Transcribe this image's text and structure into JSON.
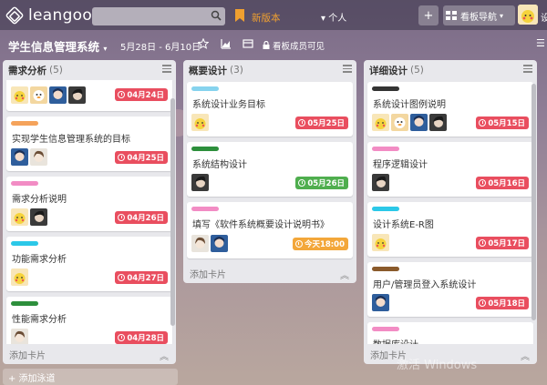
{
  "app": {
    "logo_text": "leangoo"
  },
  "topbar": {
    "search_placeholder": "",
    "new_version": "新版本",
    "personal": "个人",
    "add_symbol": "+",
    "board_nav": "看板导航",
    "more": "设"
  },
  "board": {
    "title": "学生信息管理系统",
    "dates": "5月28日 - 6月10日",
    "visibility": "看板成员可见"
  },
  "lists": [
    {
      "title": "需求分析",
      "count": "(5)",
      "add_card": "添加卡片",
      "cards": [
        {
          "label_color": "",
          "title": "",
          "members": [
            "pikachu",
            "penguin",
            "blue-girl",
            "dark-hair"
          ],
          "due": "04月24日",
          "due_color": "#e94e5f"
        },
        {
          "label_color": "#f5a35b",
          "title": "实现学生信息管理系统的目标",
          "members": [
            "blue-girl",
            "white-girl"
          ],
          "due": "04月25日",
          "due_color": "#e94e5f"
        },
        {
          "label_color": "#f28cc4",
          "title": "需求分析说明",
          "members": [
            "pikachu",
            "dark-hair"
          ],
          "due": "04月26日",
          "due_color": "#e94e5f"
        },
        {
          "label_color": "#2bc8e8",
          "title": "功能需求分析",
          "members": [
            "pikachu"
          ],
          "due": "04月27日",
          "due_color": "#e94e5f"
        },
        {
          "label_color": "#2d8f3c",
          "title": "性能需求分析",
          "members": [
            "white-girl"
          ],
          "due": "04月28日",
          "due_color": "#e94e5f"
        }
      ]
    },
    {
      "title": "概要设计",
      "count": "(3)",
      "add_card": "添加卡片",
      "cards": [
        {
          "label_color": "#86d3ee",
          "title": "系统设计业务目标",
          "members": [
            "pikachu"
          ],
          "due": "05月25日",
          "due_color": "#e94e5f"
        },
        {
          "label_color": "#2d8f3c",
          "title": "系统结构设计",
          "members": [
            "dark-hair"
          ],
          "due": "05月26日",
          "due_color": "#4fae4e"
        },
        {
          "label_color": "#f28cc4",
          "title": "填写《软件系统概要设计说明书》",
          "members": [
            "white-girl",
            "blue-girl"
          ],
          "due": "今天18:00",
          "due_color": "#f3a73a"
        }
      ]
    },
    {
      "title": "详细设计",
      "count": "(5)",
      "add_card": "添加卡片",
      "cards": [
        {
          "label_color": "#333333",
          "title": "系统设计图例说明",
          "members": [
            "pikachu",
            "penguin",
            "blue-girl",
            "dark-hair"
          ],
          "due": "05月15日",
          "due_color": "#e94e5f"
        },
        {
          "label_color": "#f28cc4",
          "title": "程序逻辑设计",
          "members": [
            "dark-hair"
          ],
          "due": "05月16日",
          "due_color": "#e94e5f"
        },
        {
          "label_color": "#2bc8e8",
          "title": "设计系统E-R图",
          "members": [
            "pikachu"
          ],
          "due": "05月17日",
          "due_color": "#e94e5f"
        },
        {
          "label_color": "#8a5a2b",
          "title": "用户/管理员登入系统设计",
          "members": [
            "blue-girl"
          ],
          "due": "05月18日",
          "due_color": "#e94e5f"
        },
        {
          "label_color": "#f28cc4",
          "title": "数据库设计",
          "members": [],
          "due": "",
          "due_color": "#e94e5f"
        }
      ]
    }
  ],
  "add_lane": "+ 添加泳道",
  "watermark": "激活 Windows"
}
